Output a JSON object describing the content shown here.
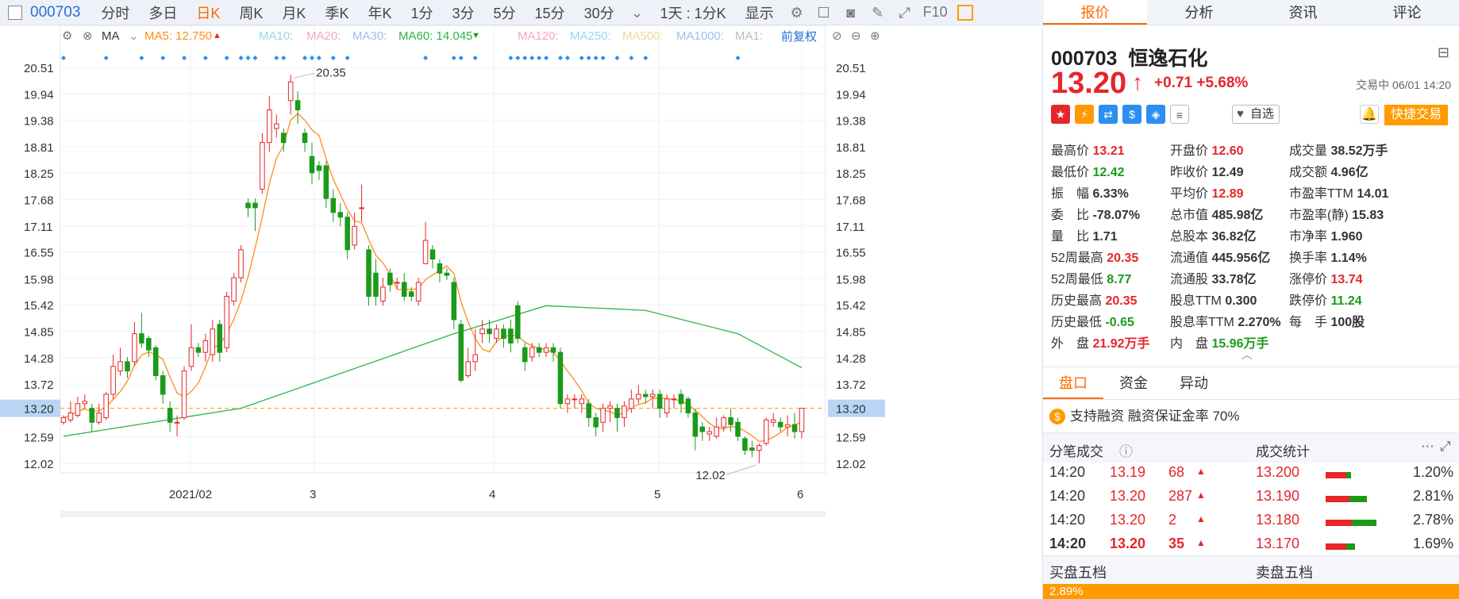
{
  "toolbar": {
    "code": "000703",
    "periods": [
      "分时",
      "多日",
      "日K",
      "周K",
      "月K",
      "季K",
      "年K",
      "1分",
      "3分",
      "5分",
      "15分",
      "30分"
    ],
    "active_period": "日K",
    "cycle_label": "1天 : 1分K",
    "display_label": "显示",
    "f10_label": "F10"
  },
  "ma_bar": {
    "ma_label": "MA",
    "ma5": "MA5: 12.750",
    "ma10": "MA10:",
    "ma20": "MA20:",
    "ma30": "MA30:",
    "ma60": "MA60: 14.045",
    "ma120": "MA120:",
    "ma250": "MA250:",
    "ma500": "MA500:",
    "ma1000": "MA1000:",
    "ma1": "MA1:",
    "adjust": "前复权"
  },
  "colors": {
    "up": "#e6262a",
    "down": "#1a9b1a",
    "ma5": "#ff8c1a",
    "ma60": "#2db34a",
    "accent": "#ff6a00",
    "blue": "#2b6fd6"
  },
  "chart_data": {
    "type": "candlestick",
    "y_ticks": [
      20.51,
      19.94,
      19.38,
      18.81,
      18.25,
      17.68,
      17.11,
      16.55,
      15.98,
      15.42,
      14.85,
      14.28,
      13.72,
      13.2,
      12.59,
      12.02
    ],
    "ylim": [
      12.02,
      20.51
    ],
    "x_labels": [
      "2021/02",
      "3",
      "4",
      "5",
      "6"
    ],
    "current_price": "13.20",
    "annotations": {
      "high": "20.35",
      "low": "12.02"
    },
    "candles": [
      [
        12.9,
        13.0,
        12.85,
        13.05
      ],
      [
        12.95,
        13.1,
        12.9,
        13.35
      ],
      [
        13.05,
        13.3,
        13.0,
        13.45
      ],
      [
        13.3,
        13.35,
        13.2,
        13.5
      ],
      [
        13.2,
        12.9,
        12.7,
        13.3
      ],
      [
        12.9,
        13.1,
        12.85,
        13.3
      ],
      [
        13.0,
        13.5,
        12.95,
        13.55
      ],
      [
        13.5,
        14.1,
        13.4,
        14.35
      ],
      [
        14.0,
        14.2,
        13.9,
        14.5
      ],
      [
        14.2,
        14.0,
        13.85,
        14.3
      ],
      [
        14.2,
        14.8,
        14.1,
        15.05
      ],
      [
        14.8,
        14.6,
        14.5,
        15.25
      ],
      [
        14.7,
        14.45,
        14.3,
        14.75
      ],
      [
        14.5,
        13.9,
        13.8,
        14.55
      ],
      [
        13.9,
        13.5,
        13.3,
        14.0
      ],
      [
        13.2,
        12.9,
        12.7,
        13.35
      ],
      [
        12.9,
        12.9,
        12.6,
        13.05
      ],
      [
        13.0,
        14.0,
        12.95,
        14.1
      ],
      [
        14.1,
        14.5,
        14.0,
        15.0
      ],
      [
        14.5,
        14.4,
        14.3,
        14.6
      ],
      [
        14.4,
        14.65,
        14.2,
        14.8
      ],
      [
        14.35,
        14.9,
        14.2,
        15.1
      ],
      [
        15.0,
        14.4,
        14.2,
        15.1
      ],
      [
        14.5,
        15.6,
        14.4,
        15.7
      ],
      [
        15.5,
        16.0,
        15.4,
        16.1
      ],
      [
        16.0,
        16.6,
        15.9,
        16.7
      ],
      [
        17.6,
        17.5,
        17.3,
        17.7
      ],
      [
        17.6,
        17.5,
        17.0,
        17.7
      ],
      [
        17.9,
        18.9,
        17.8,
        19.1
      ],
      [
        18.9,
        19.6,
        18.7,
        19.9
      ],
      [
        19.2,
        19.3,
        19.0,
        19.5
      ],
      [
        19.1,
        18.9,
        18.7,
        19.2
      ],
      [
        19.8,
        20.2,
        19.5,
        20.35
      ],
      [
        19.8,
        19.6,
        19.3,
        20.0
      ],
      [
        19.1,
        18.9,
        18.7,
        19.2
      ],
      [
        18.6,
        18.25,
        18.0,
        18.9
      ],
      [
        18.4,
        18.3,
        18.1,
        18.5
      ],
      [
        18.4,
        17.7,
        17.5,
        18.5
      ],
      [
        17.7,
        17.4,
        17.2,
        17.9
      ],
      [
        17.4,
        17.3,
        17.1,
        17.6
      ],
      [
        17.3,
        16.6,
        16.4,
        17.4
      ],
      [
        16.7,
        17.1,
        16.6,
        17.4
      ],
      [
        17.5,
        17.5,
        17.2,
        18.0
      ],
      [
        16.6,
        15.6,
        15.4,
        16.7
      ],
      [
        16.1,
        15.6,
        15.4,
        16.4
      ],
      [
        15.5,
        15.8,
        15.4,
        16.0
      ],
      [
        16.1,
        15.85,
        15.7,
        16.2
      ],
      [
        15.9,
        15.9,
        15.75,
        16.0
      ],
      [
        15.9,
        15.6,
        15.5,
        16.1
      ],
      [
        15.7,
        15.6,
        15.5,
        15.8
      ],
      [
        15.5,
        15.9,
        15.4,
        16.0
      ],
      [
        16.3,
        16.8,
        16.3,
        17.2
      ],
      [
        16.6,
        16.4,
        16.2,
        16.7
      ],
      [
        16.3,
        16.1,
        15.9,
        16.4
      ],
      [
        16.1,
        16.05,
        15.95,
        16.2
      ],
      [
        15.9,
        15.1,
        14.9,
        16.0
      ],
      [
        15.0,
        13.8,
        13.75,
        15.1
      ],
      [
        13.9,
        14.2,
        13.85,
        14.5
      ],
      [
        14.2,
        14.35,
        14.0,
        14.9
      ],
      [
        14.8,
        14.9,
        14.6,
        15.1
      ],
      [
        14.9,
        14.8,
        14.6,
        15.1
      ],
      [
        14.7,
        14.9,
        14.6,
        15.0
      ],
      [
        14.9,
        14.7,
        14.5,
        15.0
      ],
      [
        14.9,
        14.6,
        14.4,
        15.1
      ],
      [
        15.4,
        14.7,
        14.6,
        15.5
      ],
      [
        14.5,
        14.2,
        14.0,
        14.6
      ],
      [
        14.3,
        14.5,
        14.2,
        14.6
      ],
      [
        14.5,
        14.4,
        14.3,
        14.6
      ],
      [
        14.4,
        14.5,
        14.3,
        14.6
      ],
      [
        14.5,
        14.4,
        14.2,
        14.6
      ],
      [
        14.4,
        13.3,
        13.2,
        14.5
      ],
      [
        13.3,
        13.4,
        13.1,
        13.5
      ],
      [
        13.4,
        13.4,
        13.2,
        13.5
      ],
      [
        13.3,
        13.4,
        13.1,
        13.5
      ],
      [
        13.3,
        13.0,
        12.8,
        13.4
      ],
      [
        13.0,
        12.8,
        12.6,
        13.1
      ],
      [
        12.9,
        13.2,
        12.7,
        13.3
      ],
      [
        13.2,
        13.25,
        12.9,
        13.35
      ],
      [
        13.2,
        13.0,
        12.7,
        13.3
      ],
      [
        13.0,
        13.25,
        12.8,
        13.35
      ],
      [
        13.2,
        13.4,
        13.1,
        13.6
      ],
      [
        13.4,
        13.5,
        13.3,
        13.7
      ],
      [
        13.5,
        13.45,
        13.3,
        13.6
      ],
      [
        13.45,
        13.5,
        13.2,
        13.6
      ],
      [
        13.5,
        13.2,
        13.0,
        13.6
      ],
      [
        13.1,
        13.4,
        13.0,
        13.5
      ],
      [
        13.4,
        13.4,
        13.2,
        13.5
      ],
      [
        13.5,
        13.3,
        13.1,
        13.6
      ],
      [
        13.4,
        13.1,
        13.0,
        13.45
      ],
      [
        13.1,
        12.6,
        12.3,
        13.2
      ],
      [
        12.8,
        12.7,
        12.5,
        12.9
      ],
      [
        12.65,
        12.7,
        12.5,
        12.8
      ],
      [
        12.6,
        12.8,
        12.55,
        13.0
      ],
      [
        12.8,
        13.0,
        12.7,
        13.05
      ],
      [
        13.0,
        12.85,
        12.7,
        13.2
      ],
      [
        12.9,
        12.6,
        12.5,
        13.0
      ],
      [
        12.55,
        12.3,
        12.2,
        12.6
      ],
      [
        12.35,
        12.3,
        12.15,
        12.5
      ],
      [
        12.3,
        12.4,
        12.02,
        12.45
      ],
      [
        12.45,
        12.95,
        12.4,
        13.0
      ],
      [
        12.9,
        12.95,
        12.8,
        13.1
      ],
      [
        12.9,
        12.8,
        12.7,
        13.0
      ],
      [
        12.8,
        12.85,
        12.6,
        13.05
      ],
      [
        12.85,
        12.7,
        12.55,
        13.1
      ],
      [
        12.7,
        13.2,
        12.55,
        13.21
      ]
    ],
    "ma60": [
      [
        0,
        12.6
      ],
      [
        25,
        13.2
      ],
      [
        55,
        14.8
      ],
      [
        68,
        15.4
      ],
      [
        82,
        15.3
      ],
      [
        95,
        14.8
      ],
      [
        104,
        14.07
      ]
    ],
    "ma5_note": "orange line follows closes"
  },
  "quote": {
    "tabs": [
      "报价",
      "分析",
      "资讯",
      "评论"
    ],
    "code": "000703",
    "name": "恒逸石化",
    "price": "13.20",
    "change": "+0.71",
    "change_pct": "+5.68%",
    "status": "交易中 06/01 14:20",
    "add_watch": "自选",
    "quick_trade": "快捷交易",
    "fields": [
      [
        [
          "最高价",
          "13.21",
          "red"
        ],
        [
          "开盘价",
          "12.60",
          "red"
        ],
        [
          "成交量",
          "38.52万手",
          "dark"
        ]
      ],
      [
        [
          "最低价",
          "12.42",
          "green"
        ],
        [
          "昨收价",
          "12.49",
          "dark"
        ],
        [
          "成交额",
          "4.96亿",
          "dark"
        ]
      ],
      [
        [
          "振　幅",
          "6.33%",
          "dark"
        ],
        [
          "平均价",
          "12.89",
          "red"
        ],
        [
          "市盈率TTM",
          "14.01",
          "dark"
        ]
      ],
      [
        [
          "委　比",
          "-78.07%",
          "dark"
        ],
        [
          "总市值",
          "485.98亿",
          "dark"
        ],
        [
          "市盈率(静)",
          "15.83",
          "dark"
        ]
      ],
      [
        [
          "量　比",
          "1.71",
          "dark"
        ],
        [
          "总股本",
          "36.82亿",
          "dark"
        ],
        [
          "市净率",
          "1.960",
          "dark"
        ]
      ],
      [
        [
          "52周最高",
          "20.35",
          "red"
        ],
        [
          "流通值",
          "445.956亿",
          "dark"
        ],
        [
          "换手率",
          "1.14%",
          "dark"
        ]
      ],
      [
        [
          "52周最低",
          "8.77",
          "green"
        ],
        [
          "流通股",
          "33.78亿",
          "dark"
        ],
        [
          "涨停价",
          "13.74",
          "red"
        ]
      ],
      [
        [
          "历史最高",
          "20.35",
          "red"
        ],
        [
          "股息TTM",
          "0.300",
          "dark"
        ],
        [
          "跌停价",
          "11.24",
          "green"
        ]
      ],
      [
        [
          "历史最低",
          "-0.65",
          "green"
        ],
        [
          "股息率TTM",
          "2.270%",
          "dark"
        ],
        [
          "每　手",
          "100股",
          "dark"
        ]
      ],
      [
        [
          "外　盘",
          "21.92万手",
          "red"
        ],
        [
          "内　盘",
          "15.96万手",
          "green"
        ]
      ]
    ],
    "subtabs": [
      "盘口",
      "资金",
      "异动"
    ],
    "margin_text": "支持融资 融资保证金率 70%",
    "trades_title": "分笔成交",
    "stats_title": "成交统计",
    "trades": [
      [
        "14:20",
        "13.19",
        "68"
      ],
      [
        "14:20",
        "13.20",
        "287"
      ],
      [
        "14:20",
        "13.20",
        "2"
      ],
      [
        "14:20",
        "13.20",
        "35"
      ]
    ],
    "stats": [
      [
        "13.200",
        "1.20%",
        0.24,
        0.05
      ],
      [
        "13.190",
        "2.81%",
        0.27,
        0.2
      ],
      [
        "13.180",
        "2.78%",
        0.3,
        0.28
      ],
      [
        "13.170",
        "1.69%",
        0.24,
        0.1
      ]
    ],
    "buy5": "买盘五档",
    "sell5": "卖盘五档",
    "bottom_pct": "2.89%"
  }
}
